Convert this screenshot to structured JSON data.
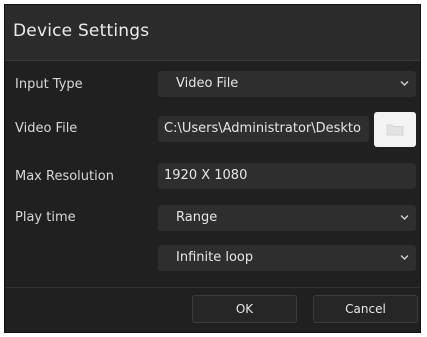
{
  "dialog": {
    "title": "Device Settings"
  },
  "form": {
    "input_type": {
      "label": "Input Type",
      "value": "Video File"
    },
    "video_file": {
      "label": "Video File",
      "value": "C:\\Users\\Administrator\\Deskto",
      "browse_icon": "folder-icon"
    },
    "max_resolution": {
      "label": "Max Resolution",
      "value": "1920 X 1080"
    },
    "play_time": {
      "label": "Play time",
      "value": "Range"
    },
    "loop": {
      "value": "Infinite loop"
    }
  },
  "buttons": {
    "ok_label": "OK",
    "cancel_label": "Cancel"
  },
  "colors": {
    "background": "#202020",
    "title_bar": "#2b2b2b",
    "field": "#2e2e2e",
    "text": "#e6e6e6",
    "browse_button": "#f3f3f3"
  }
}
